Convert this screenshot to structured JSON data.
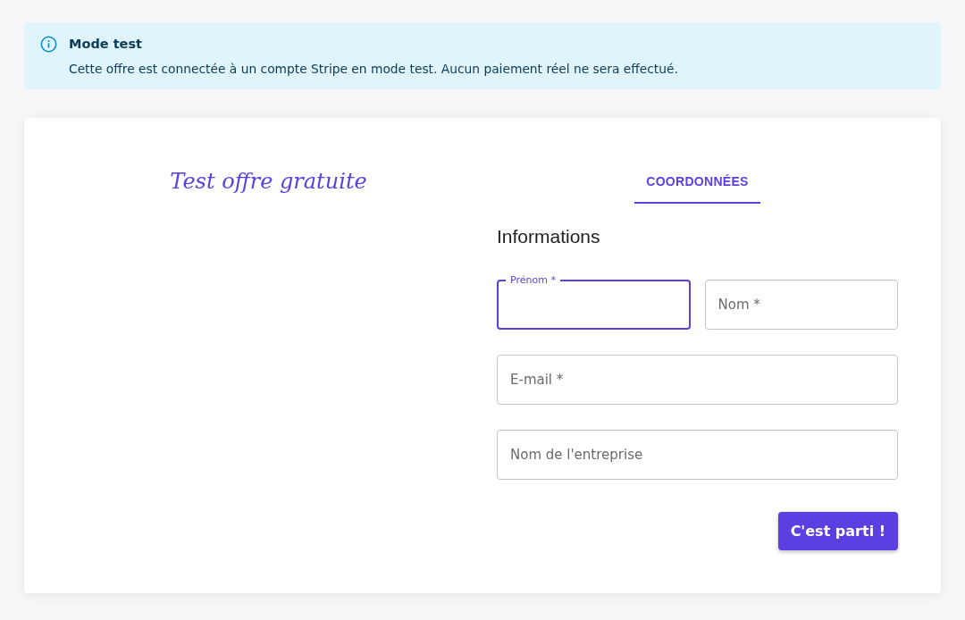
{
  "alert": {
    "title": "Mode test",
    "message": "Cette offre est connectée à un compte Stripe en mode test. Aucun paiement réel ne sera effectué."
  },
  "offer": {
    "title": "Test offre gratuite"
  },
  "tabs": [
    {
      "label": "COORDONNÉES",
      "selected": true
    }
  ],
  "form": {
    "heading": "Informations",
    "rows": [
      [
        {
          "label": "Prénom *",
          "focused": true
        },
        {
          "label": "Nom *",
          "focused": false
        }
      ],
      [
        {
          "label": "E-mail *",
          "focused": false
        }
      ],
      [
        {
          "label": "Nom de l'entreprise",
          "focused": false
        }
      ]
    ],
    "submit": "C'est parti !"
  }
}
